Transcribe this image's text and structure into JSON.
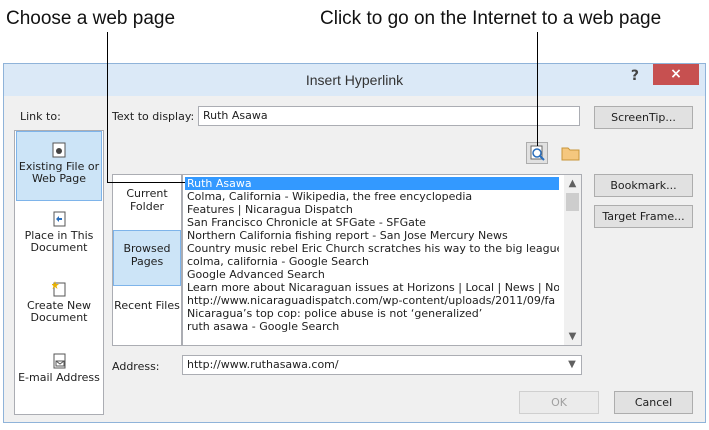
{
  "callouts": {
    "left": "Choose a web page",
    "right": "Click to go on the Internet to a web page"
  },
  "dialog": {
    "title": "Insert Hyperlink",
    "help": "?",
    "close": "×"
  },
  "link_to": {
    "label": "Link to:",
    "items": [
      {
        "label": "Existing File or Web Page",
        "icon": "existing-file-icon",
        "selected": true
      },
      {
        "label": "Place in This Document",
        "icon": "place-in-document-icon",
        "selected": false
      },
      {
        "label": "Create New Document",
        "icon": "new-document-icon",
        "selected": false
      },
      {
        "label": "E-mail Address",
        "icon": "email-icon",
        "selected": false
      }
    ]
  },
  "text_to_display": {
    "label": "Text to display:",
    "value": "Ruth Asawa"
  },
  "buttons": {
    "screentip": "ScreenTip...",
    "bookmark": "Bookmark...",
    "target_frame": "Target Frame...",
    "ok": "OK",
    "cancel": "Cancel"
  },
  "browse_icons": [
    "browse-web-icon",
    "browse-file-icon"
  ],
  "sources": [
    {
      "label": "Current Folder",
      "selected": false
    },
    {
      "label": "Browsed Pages",
      "selected": true
    },
    {
      "label": "Recent Files",
      "selected": false
    }
  ],
  "pages": [
    "Ruth Asawa",
    "Colma, California - Wikipedia, the free encyclopedia",
    "Features | Nicaragua Dispatch",
    "San Francisco Chronicle at SFGate - SFGate",
    "Northern California fishing report - San Jose Mercury News",
    "Country music rebel Eric Church scratches his way to the big league",
    "colma, california - Google Search",
    "Google Advanced Search",
    "Learn more about Nicaraguan issues at Horizons | Local | News | Nor",
    "http://www.nicaraguadispatch.com/wp-content/uploads/2011/09/fa",
    "Nicaragua’s top cop: police abuse is not ‘generalized’",
    "ruth asawa - Google Search"
  ],
  "address": {
    "label": "Address:",
    "value": "http://www.ruthasawa.com/"
  },
  "colors": {
    "selection": "#3399ff",
    "titlebar": "#dbe9f7",
    "close": "#c75050"
  }
}
